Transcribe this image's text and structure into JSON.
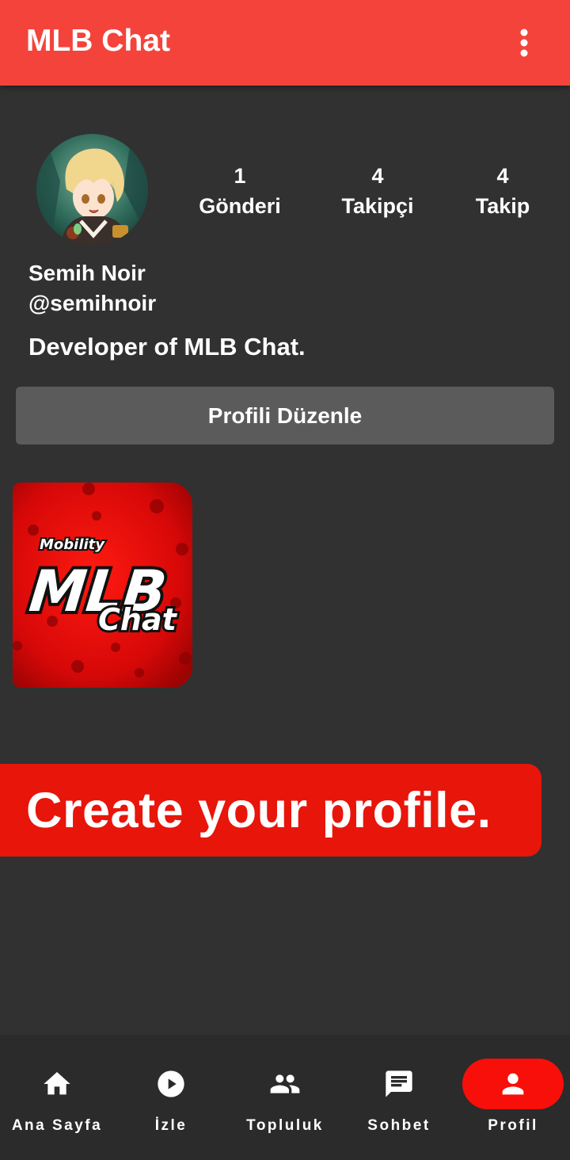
{
  "app": {
    "title": "MLB Chat",
    "accent_color": "#f4433b",
    "menu_icon": "more-vert-icon"
  },
  "profile": {
    "display_name": "Semih Noir",
    "username": "@semihnoir",
    "bio": "Developer of MLB Chat.",
    "stats": [
      {
        "value": "1",
        "label": "Gönderi"
      },
      {
        "value": "4",
        "label": "Takipçi"
      },
      {
        "value": "4",
        "label": "Takip"
      }
    ],
    "edit_button_label": "Profili Düzenle"
  },
  "posts": [
    {
      "logo_small": "Mobility",
      "logo_big": "MLB",
      "logo_sub": "Chat"
    }
  ],
  "promo": {
    "text": "Create your profile.",
    "color": "#e8150b"
  },
  "bottom_nav": {
    "active_color": "#f80f0a",
    "items": [
      {
        "label": "Ana Sayfa",
        "icon": "home-icon"
      },
      {
        "label": "İzle",
        "icon": "play-circle-icon"
      },
      {
        "label": "Topluluk",
        "icon": "people-icon"
      },
      {
        "label": "Sohbet",
        "icon": "chat-icon"
      },
      {
        "label": "Profil",
        "icon": "person-icon",
        "active": true
      }
    ]
  }
}
